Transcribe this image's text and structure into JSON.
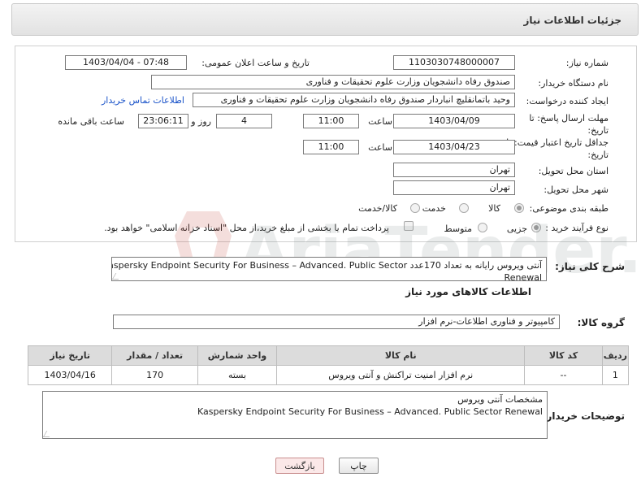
{
  "header": {
    "title": "جزئیات اطلاعات نیاز"
  },
  "form": {
    "need_number": {
      "label": "شماره نیاز:",
      "value": "1103030748000007"
    },
    "announce": {
      "label": "تاریخ و ساعت اعلان عمومی:",
      "value": "1403/04/04 - 07:48"
    },
    "buyer_org": {
      "label": "نام دستگاه خریدار:",
      "value": "صندوق رفاه دانشجویان وزارت علوم  تحقیقات و فناوری"
    },
    "requester": {
      "label": "ایجاد کننده درخواست:",
      "value": "وحید باتمانقلیچ انباردار صندوق رفاه دانشجویان وزارت علوم  تحقیقات و فناوری",
      "contact_link": "اطلاعات تماس خریدار"
    },
    "reply_deadline": {
      "label": "مهلت ارسال پاسخ: تا تاریخ:",
      "date": "1403/04/09",
      "time_label": "ساعت",
      "time": "11:00",
      "days": "4",
      "days_label": "روز و",
      "remaining": "23:06:11",
      "remaining_label": "ساعت باقی مانده"
    },
    "price_validity": {
      "label": "جداقل تاریخ اعتبار قیمت: تا تاریخ:",
      "date": "1403/04/23",
      "time_label": "ساعت",
      "time": "11:00"
    },
    "province": {
      "label": "استان محل تحویل:",
      "value": "تهران"
    },
    "city": {
      "label": "شهر محل تحویل:",
      "value": "تهران"
    },
    "category": {
      "label": "طبقه بندی موضوعی:",
      "options": [
        "کالا",
        "خدمت",
        "کالا/خدمت"
      ],
      "selected": "کالا"
    },
    "purchase_type": {
      "label": "نوع فرآیند خرید :",
      "options": [
        "جزیی",
        "متوسط"
      ],
      "selected": "جزیی",
      "note": "پرداخت تمام یا بخشی از مبلغ خرید،از محل \"اسناد خزانه اسلامی\" خواهد بود."
    }
  },
  "summary": {
    "label": "شرح کلی نیاز:",
    "line1": "آنتی ویروس رایانه  به تعداد 170عدد  Kaspersky Endpoint Security For Business – Advanced. Public Sector",
    "line2": "Renewal"
  },
  "goods": {
    "section_title": "اطلاعات کالاهای مورد نیاز",
    "group_label": "گروه کالا:",
    "group_value": "کامپیوتر و فناوری اطلاعات-نرم افزار",
    "columns": [
      "ردیف",
      "کد کالا",
      "نام کالا",
      "واحد شمارش",
      "تعداد / مقدار",
      "تاریخ نیاز"
    ],
    "rows": [
      [
        "1",
        "--",
        "نرم افزار امنیت تراکنش و آنتی ویروس",
        "بسته",
        "170",
        "1403/04/16"
      ]
    ]
  },
  "buyer_notes": {
    "label": "توضیحات خریدار:",
    "line1": "مشخصات آنتی ویروس",
    "line2": "Kaspersky Endpoint Security For Business – Advanced. Public Sector Renewal"
  },
  "buttons": {
    "print": "چاپ",
    "back": "بازگشت"
  },
  "watermark": {
    "text": "AriaTender.net"
  }
}
